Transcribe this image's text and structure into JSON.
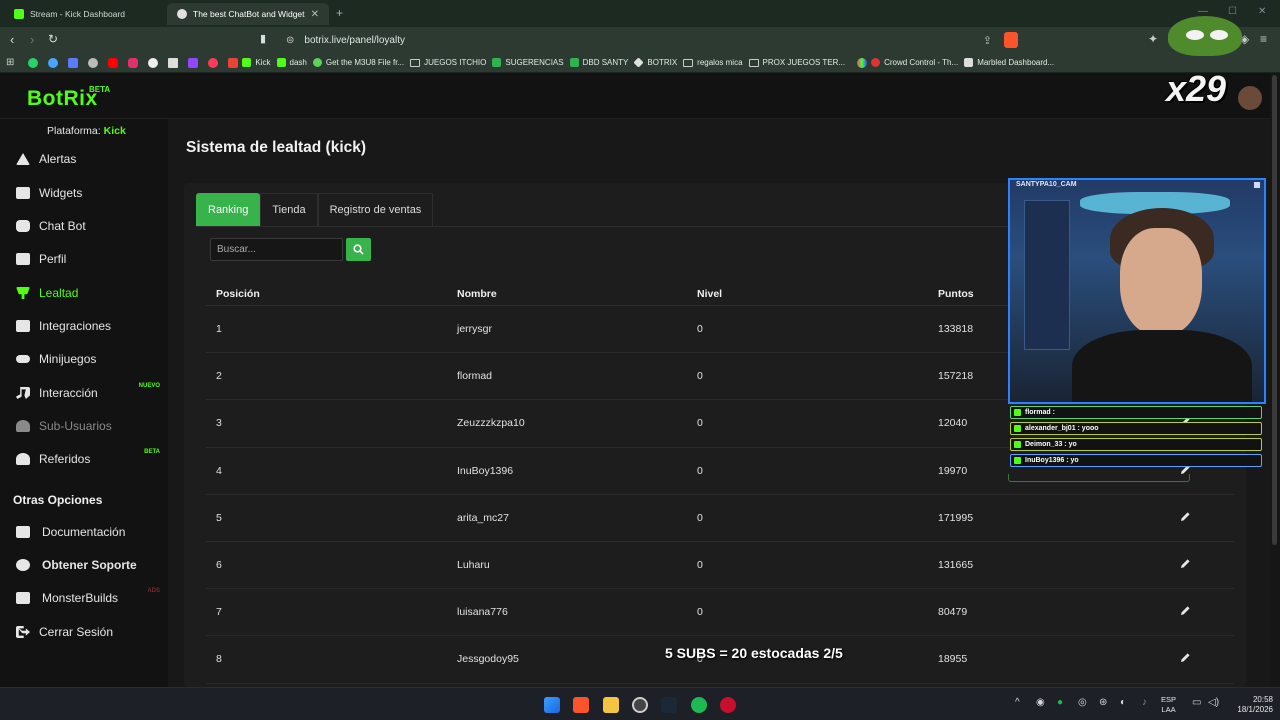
{
  "browser": {
    "tabs": [
      {
        "title": "Stream - Kick Dashboard",
        "fav_color": "#53fc18"
      },
      {
        "title": "The best ChatBot and Widgets fo",
        "fav_color": "#e0e0e0"
      }
    ],
    "url": "botrix.live/panel/loyalty",
    "bookmarks": [
      {
        "label": "Kick",
        "kind": "sq",
        "color": "#53fc18"
      },
      {
        "label": "dash",
        "kind": "sq",
        "color": "#53fc18"
      },
      {
        "label": "Get the M3U8 File fr...",
        "kind": "sq",
        "color": "#5bd35b"
      },
      {
        "label": "JUEGOS ITCHIO",
        "kind": "fold",
        "color": ""
      },
      {
        "label": "SUGERENCIAS",
        "kind": "sq",
        "color": "#2fb34f"
      },
      {
        "label": "DBD SANTY",
        "kind": "sq",
        "color": "#2fb34f"
      },
      {
        "label": "BOTRIX",
        "kind": "sq",
        "color": "#e0e0e0"
      },
      {
        "label": "regalos mica",
        "kind": "fold",
        "color": ""
      },
      {
        "label": "PROX JUEGOS TER...",
        "kind": "fold",
        "color": ""
      },
      {
        "label": "Crowd Control - Th...",
        "kind": "sq",
        "color": "#d33"
      },
      {
        "label": "Marbled Dashboard...",
        "kind": "sq",
        "color": "#ddd"
      }
    ]
  },
  "app": {
    "logo": "BotRix",
    "logo_badge": "BETA",
    "platform_label": "Plataforma:",
    "platform_value": "Kick",
    "nav": [
      {
        "label": "Alertas",
        "icon": "warning-icon",
        "state": "normal",
        "badge": ""
      },
      {
        "label": "Widgets",
        "icon": "grid-icon",
        "state": "normal",
        "badge": ""
      },
      {
        "label": "Chat Bot",
        "icon": "robot-icon",
        "state": "normal",
        "badge": ""
      },
      {
        "label": "Perfil",
        "icon": "id-card-icon",
        "state": "normal",
        "badge": ""
      },
      {
        "label": "Lealtad",
        "icon": "trophy-icon",
        "state": "active",
        "badge": ""
      },
      {
        "label": "Integraciones",
        "icon": "newspaper-icon",
        "state": "normal",
        "badge": ""
      },
      {
        "label": "Minijuegos",
        "icon": "gamepad-icon",
        "state": "normal",
        "badge": ""
      },
      {
        "label": "Interacción",
        "icon": "music-icon",
        "state": "normal",
        "badge": "NUEVO"
      },
      {
        "label": "Sub-Usuarios",
        "icon": "users-icon",
        "state": "muted",
        "badge": ""
      },
      {
        "label": "Referidos",
        "icon": "user-friends-icon",
        "state": "normal",
        "badge": "BETA"
      }
    ],
    "other_title": "Otras Opciones",
    "other": [
      {
        "label": "Documentación",
        "icon": "book-icon",
        "bold": false,
        "badge": ""
      },
      {
        "label": "Obtener Soporte",
        "icon": "question-icon",
        "bold": true,
        "badge": ""
      },
      {
        "label": "MonsterBuilds",
        "icon": "laptop-icon",
        "bold": false,
        "badge": "ADS"
      },
      {
        "label": "Cerrar Sesión",
        "icon": "sign-out-icon",
        "bold": false,
        "badge": ""
      }
    ],
    "page_title": "Sistema de lealtad (kick)",
    "tabs": [
      "Ranking",
      "Tienda",
      "Registro de ventas"
    ],
    "search_placeholder": "Buscar...",
    "table": {
      "headers": [
        "Posición",
        "Nombre",
        "Nivel",
        "Puntos"
      ],
      "rows": [
        [
          "1",
          "jerrysgr",
          "0",
          "133818"
        ],
        [
          "2",
          "flormad",
          "0",
          "157218"
        ],
        [
          "3",
          "Zeuzzzkzpa10",
          "0",
          "12040"
        ],
        [
          "4",
          "InuBoy1396",
          "0",
          "19970"
        ],
        [
          "5",
          "arita_mc27",
          "0",
          "171995"
        ],
        [
          "6",
          "Luharu",
          "0",
          "131665"
        ],
        [
          "7",
          "luisana776",
          "0",
          "80479"
        ],
        [
          "8",
          "Jessgodoy95",
          "0",
          "18955"
        ]
      ]
    }
  },
  "overlay": {
    "cam_label": "SANTYPA10_CAM",
    "chat": [
      {
        "text": "flormad : ",
        "style": "mint"
      },
      {
        "text": "alexander_bj01 : yooo",
        "style": "yellow"
      },
      {
        "text": "Deimon_33 : yo",
        "style": "yellow"
      },
      {
        "text": "InuBoy1396 : yo",
        "style": "blue"
      }
    ],
    "combo": "x29",
    "subs_goal": "5 SUBS = 20 estocadas 2/5"
  },
  "taskbar": {
    "lang": "ESP",
    "region": "LAA",
    "time": "20:58",
    "date": "18/1/2026"
  }
}
